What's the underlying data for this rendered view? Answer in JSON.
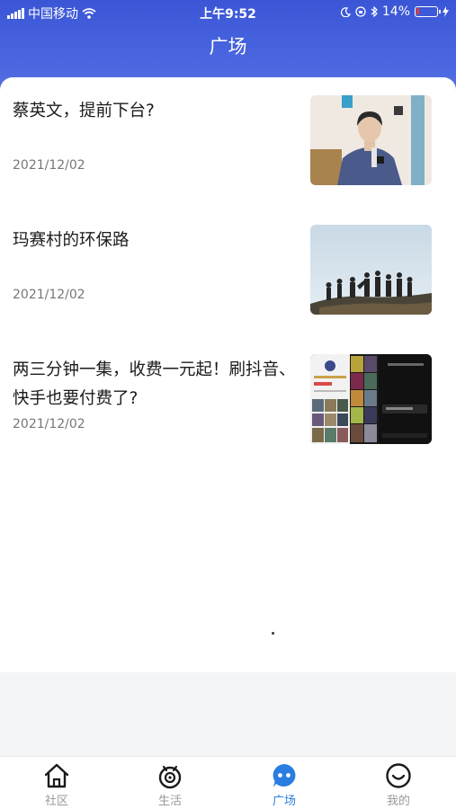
{
  "status_bar": {
    "carrier": "中国移动",
    "time": "上午9:52",
    "battery_percent": "14%",
    "battery_level": 0.14
  },
  "header": {
    "title": "广场"
  },
  "articles": [
    {
      "title": "蔡英文，提前下台?",
      "date": "2021/12/02"
    },
    {
      "title": "玛赛村的环保路",
      "date": "2021/12/02"
    },
    {
      "title": "两三分钟一集，收费一元起！刷抖音、快手也要付费了?",
      "date": "2021/12/02"
    }
  ],
  "tabs": [
    {
      "label": "社区",
      "icon": "home-icon",
      "active": false
    },
    {
      "label": "生活",
      "icon": "eye-icon",
      "active": false
    },
    {
      "label": "广场",
      "icon": "chat-bubble-icon",
      "active": true
    },
    {
      "label": "我的",
      "icon": "smile-icon",
      "active": false
    }
  ],
  "colors": {
    "header": "#3a56d6",
    "accent": "#2a7de1",
    "inactive": "#999999",
    "battery_low": "#e53935"
  }
}
